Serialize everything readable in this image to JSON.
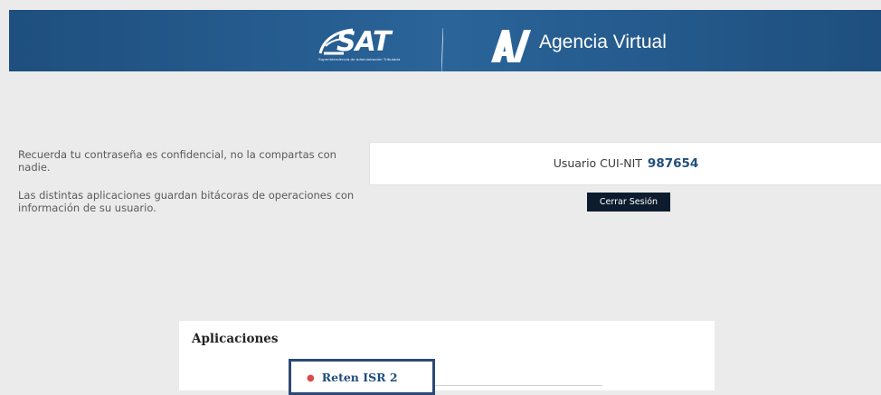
{
  "header": {
    "sat_logo_text": "SAT",
    "sat_logo_subtitle": "Superintendencia de Administración Tributaria",
    "av_logo_text": "AV",
    "title": "Agencia Virtual"
  },
  "notices": [
    "Recuerda tu contraseña es confidencial, no la compartas con nadie.",
    "Las distintas aplicaciones guardan bitácoras de operaciones con información de su usuario."
  ],
  "user": {
    "label": "Usuario CUI-NIT",
    "nit": "987654"
  },
  "logout_label": "Cerrar Sesión",
  "apps": {
    "title": "Aplicaciones",
    "items": [
      {
        "label": "Reten ISR 2"
      }
    ]
  },
  "colors": {
    "header_bg": "#235a8c",
    "button_bg": "#0c1c2e",
    "link": "#1f4c7e",
    "bullet": "#d94a4a",
    "highlight_border": "#2c4a75"
  }
}
